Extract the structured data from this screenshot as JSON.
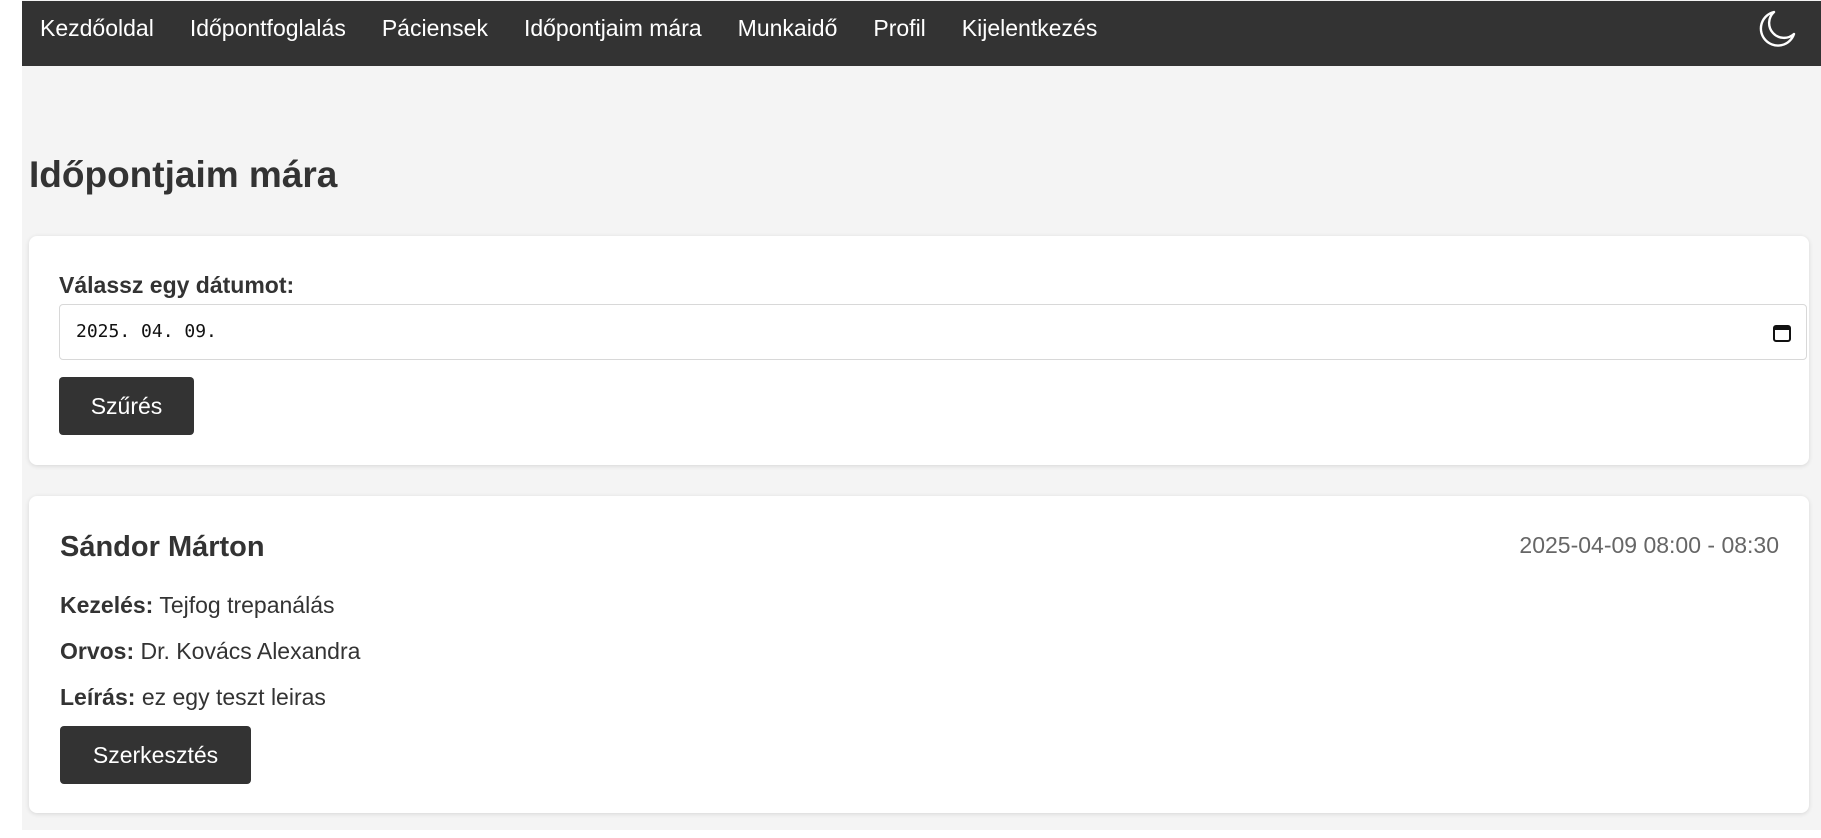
{
  "navbar": {
    "links": [
      {
        "label": "Kezdőoldal"
      },
      {
        "label": "Időpontfoglalás"
      },
      {
        "label": "Páciensek"
      },
      {
        "label": "Időpontjaim mára"
      },
      {
        "label": "Munkaidő"
      },
      {
        "label": "Profil"
      },
      {
        "label": "Kijelentkezés"
      }
    ],
    "theme_toggle_icon": "moon-icon"
  },
  "page": {
    "title": "Időpontjaim mára"
  },
  "filter": {
    "label": "Válassz egy dátumot:",
    "date_value": "2025. 04. 09.",
    "calendar_icon": "calendar-icon",
    "button_label": "Szűrés"
  },
  "appointments": [
    {
      "patient_name": "Sándor Márton",
      "time_range": "2025-04-09 08:00 - 08:30",
      "treatment_label": "Kezelés:",
      "treatment": "Tejfog trepanálás",
      "doctor_label": "Orvos:",
      "doctor": "Dr. Kovács Alexandra",
      "description_label": "Leírás:",
      "description": "ez egy teszt leiras",
      "edit_label": "Szerkesztés"
    }
  ],
  "colors": {
    "navbar_bg": "#333333",
    "page_bg": "#f4f4f4",
    "card_bg": "#ffffff",
    "button_bg": "#333333",
    "text": "#333333",
    "muted_text": "#666666"
  }
}
